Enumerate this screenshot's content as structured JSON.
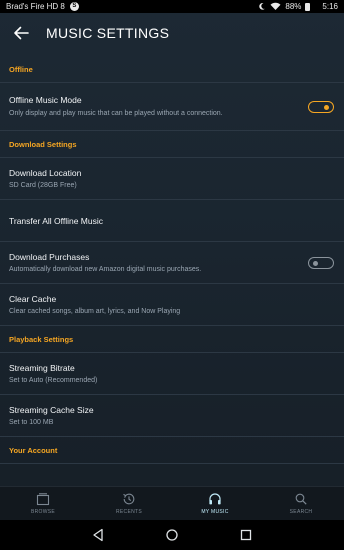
{
  "status_bar": {
    "device_name": "Brad's Fire HD 8",
    "notification_badge": "S",
    "battery": "88%",
    "time": "5:16"
  },
  "header": {
    "title": "MUSIC SETTINGS",
    "back_icon": "arrow-left-icon"
  },
  "sections": {
    "offline": "Offline",
    "download": "Download Settings",
    "playback": "Playback Settings",
    "account": "Your Account"
  },
  "settings": {
    "offline_mode": {
      "title": "Offline Music Mode",
      "subtitle": "Only display and play music that can be played without a connection.",
      "enabled": true
    },
    "download_location": {
      "title": "Download Location",
      "subtitle": "SD Card (28GB Free)"
    },
    "transfer_offline": {
      "title": "Transfer All Offline Music"
    },
    "download_purchases": {
      "title": "Download Purchases",
      "subtitle": "Automatically download new Amazon digital music purchases.",
      "enabled": false
    },
    "clear_cache": {
      "title": "Clear Cache",
      "subtitle": "Clear cached songs, album art, lyrics, and Now Playing"
    },
    "streaming_bitrate": {
      "title": "Streaming Bitrate",
      "subtitle": "Set to Auto (Recommended)"
    },
    "streaming_cache": {
      "title": "Streaming Cache Size",
      "subtitle": "Set to 100 MB"
    }
  },
  "tabs": [
    {
      "label": "BROWSE",
      "icon": "browse-icon",
      "active": false
    },
    {
      "label": "RECENTS",
      "icon": "history-icon",
      "active": false
    },
    {
      "label": "MY MUSIC",
      "icon": "headphones-icon",
      "active": true
    },
    {
      "label": "SEARCH",
      "icon": "search-icon",
      "active": false
    }
  ],
  "colors": {
    "accent": "#f5a623",
    "active_tab": "#bfe9f7",
    "background": "#1a252f"
  }
}
